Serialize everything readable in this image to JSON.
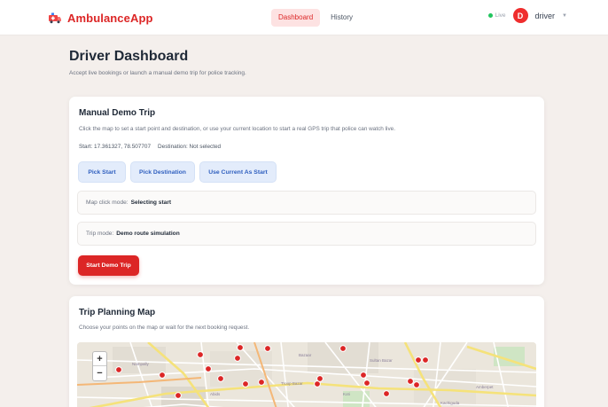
{
  "nav": {
    "brand": "AmbulanceApp",
    "tabs": [
      {
        "label": "Dashboard",
        "active": true
      },
      {
        "label": "History",
        "active": false
      }
    ],
    "live_label": "Live",
    "avatar_initial": "D",
    "username": "driver",
    "caret": "▼"
  },
  "header": {
    "title": "Driver Dashboard",
    "subtitle": "Accept live bookings or launch a manual demo trip for police tracking."
  },
  "manual_trip": {
    "title": "Manual Demo Trip",
    "description": "Click the map to set a start point and destination, or use your current location to start a real GPS trip that police can watch live.",
    "start_label": "Start: 17.361327, 78.507707",
    "destination_label": "Destination: Not selected",
    "buttons": {
      "pick_start": "Pick Start",
      "pick_destination": "Pick Destination",
      "use_current": "Use Current As Start"
    },
    "map_click_mode_label": "Map click mode:",
    "map_click_mode_value": "Selecting start",
    "trip_mode_label": "Trip mode:",
    "trip_mode_value": "Demo route simulation",
    "start_button": "Start Demo Trip"
  },
  "planning_map": {
    "title": "Trip Planning Map",
    "description": "Choose your points on the map or wait for the next booking request.",
    "zoom_in": "+",
    "zoom_out": "−"
  },
  "colors": {
    "brand": "#dc2626",
    "accent_light": "#e3ecfb",
    "live": "#22c55e"
  }
}
